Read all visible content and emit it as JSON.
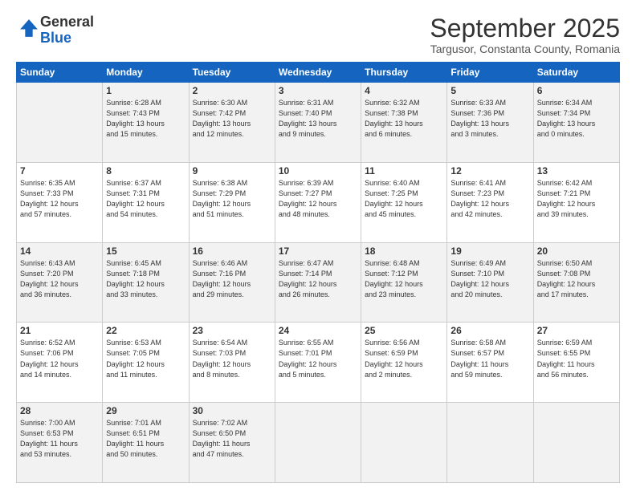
{
  "logo": {
    "general": "General",
    "blue": "Blue"
  },
  "header": {
    "month": "September 2025",
    "location": "Targusor, Constanta County, Romania"
  },
  "weekdays": [
    "Sunday",
    "Monday",
    "Tuesday",
    "Wednesday",
    "Thursday",
    "Friday",
    "Saturday"
  ],
  "weeks": [
    [
      {
        "day": "",
        "info": ""
      },
      {
        "day": "1",
        "info": "Sunrise: 6:28 AM\nSunset: 7:43 PM\nDaylight: 13 hours\nand 15 minutes."
      },
      {
        "day": "2",
        "info": "Sunrise: 6:30 AM\nSunset: 7:42 PM\nDaylight: 13 hours\nand 12 minutes."
      },
      {
        "day": "3",
        "info": "Sunrise: 6:31 AM\nSunset: 7:40 PM\nDaylight: 13 hours\nand 9 minutes."
      },
      {
        "day": "4",
        "info": "Sunrise: 6:32 AM\nSunset: 7:38 PM\nDaylight: 13 hours\nand 6 minutes."
      },
      {
        "day": "5",
        "info": "Sunrise: 6:33 AM\nSunset: 7:36 PM\nDaylight: 13 hours\nand 3 minutes."
      },
      {
        "day": "6",
        "info": "Sunrise: 6:34 AM\nSunset: 7:34 PM\nDaylight: 13 hours\nand 0 minutes."
      }
    ],
    [
      {
        "day": "7",
        "info": "Sunrise: 6:35 AM\nSunset: 7:33 PM\nDaylight: 12 hours\nand 57 minutes."
      },
      {
        "day": "8",
        "info": "Sunrise: 6:37 AM\nSunset: 7:31 PM\nDaylight: 12 hours\nand 54 minutes."
      },
      {
        "day": "9",
        "info": "Sunrise: 6:38 AM\nSunset: 7:29 PM\nDaylight: 12 hours\nand 51 minutes."
      },
      {
        "day": "10",
        "info": "Sunrise: 6:39 AM\nSunset: 7:27 PM\nDaylight: 12 hours\nand 48 minutes."
      },
      {
        "day": "11",
        "info": "Sunrise: 6:40 AM\nSunset: 7:25 PM\nDaylight: 12 hours\nand 45 minutes."
      },
      {
        "day": "12",
        "info": "Sunrise: 6:41 AM\nSunset: 7:23 PM\nDaylight: 12 hours\nand 42 minutes."
      },
      {
        "day": "13",
        "info": "Sunrise: 6:42 AM\nSunset: 7:21 PM\nDaylight: 12 hours\nand 39 minutes."
      }
    ],
    [
      {
        "day": "14",
        "info": "Sunrise: 6:43 AM\nSunset: 7:20 PM\nDaylight: 12 hours\nand 36 minutes."
      },
      {
        "day": "15",
        "info": "Sunrise: 6:45 AM\nSunset: 7:18 PM\nDaylight: 12 hours\nand 33 minutes."
      },
      {
        "day": "16",
        "info": "Sunrise: 6:46 AM\nSunset: 7:16 PM\nDaylight: 12 hours\nand 29 minutes."
      },
      {
        "day": "17",
        "info": "Sunrise: 6:47 AM\nSunset: 7:14 PM\nDaylight: 12 hours\nand 26 minutes."
      },
      {
        "day": "18",
        "info": "Sunrise: 6:48 AM\nSunset: 7:12 PM\nDaylight: 12 hours\nand 23 minutes."
      },
      {
        "day": "19",
        "info": "Sunrise: 6:49 AM\nSunset: 7:10 PM\nDaylight: 12 hours\nand 20 minutes."
      },
      {
        "day": "20",
        "info": "Sunrise: 6:50 AM\nSunset: 7:08 PM\nDaylight: 12 hours\nand 17 minutes."
      }
    ],
    [
      {
        "day": "21",
        "info": "Sunrise: 6:52 AM\nSunset: 7:06 PM\nDaylight: 12 hours\nand 14 minutes."
      },
      {
        "day": "22",
        "info": "Sunrise: 6:53 AM\nSunset: 7:05 PM\nDaylight: 12 hours\nand 11 minutes."
      },
      {
        "day": "23",
        "info": "Sunrise: 6:54 AM\nSunset: 7:03 PM\nDaylight: 12 hours\nand 8 minutes."
      },
      {
        "day": "24",
        "info": "Sunrise: 6:55 AM\nSunset: 7:01 PM\nDaylight: 12 hours\nand 5 minutes."
      },
      {
        "day": "25",
        "info": "Sunrise: 6:56 AM\nSunset: 6:59 PM\nDaylight: 12 hours\nand 2 minutes."
      },
      {
        "day": "26",
        "info": "Sunrise: 6:58 AM\nSunset: 6:57 PM\nDaylight: 11 hours\nand 59 minutes."
      },
      {
        "day": "27",
        "info": "Sunrise: 6:59 AM\nSunset: 6:55 PM\nDaylight: 11 hours\nand 56 minutes."
      }
    ],
    [
      {
        "day": "28",
        "info": "Sunrise: 7:00 AM\nSunset: 6:53 PM\nDaylight: 11 hours\nand 53 minutes."
      },
      {
        "day": "29",
        "info": "Sunrise: 7:01 AM\nSunset: 6:51 PM\nDaylight: 11 hours\nand 50 minutes."
      },
      {
        "day": "30",
        "info": "Sunrise: 7:02 AM\nSunset: 6:50 PM\nDaylight: 11 hours\nand 47 minutes."
      },
      {
        "day": "",
        "info": ""
      },
      {
        "day": "",
        "info": ""
      },
      {
        "day": "",
        "info": ""
      },
      {
        "day": "",
        "info": ""
      }
    ]
  ]
}
